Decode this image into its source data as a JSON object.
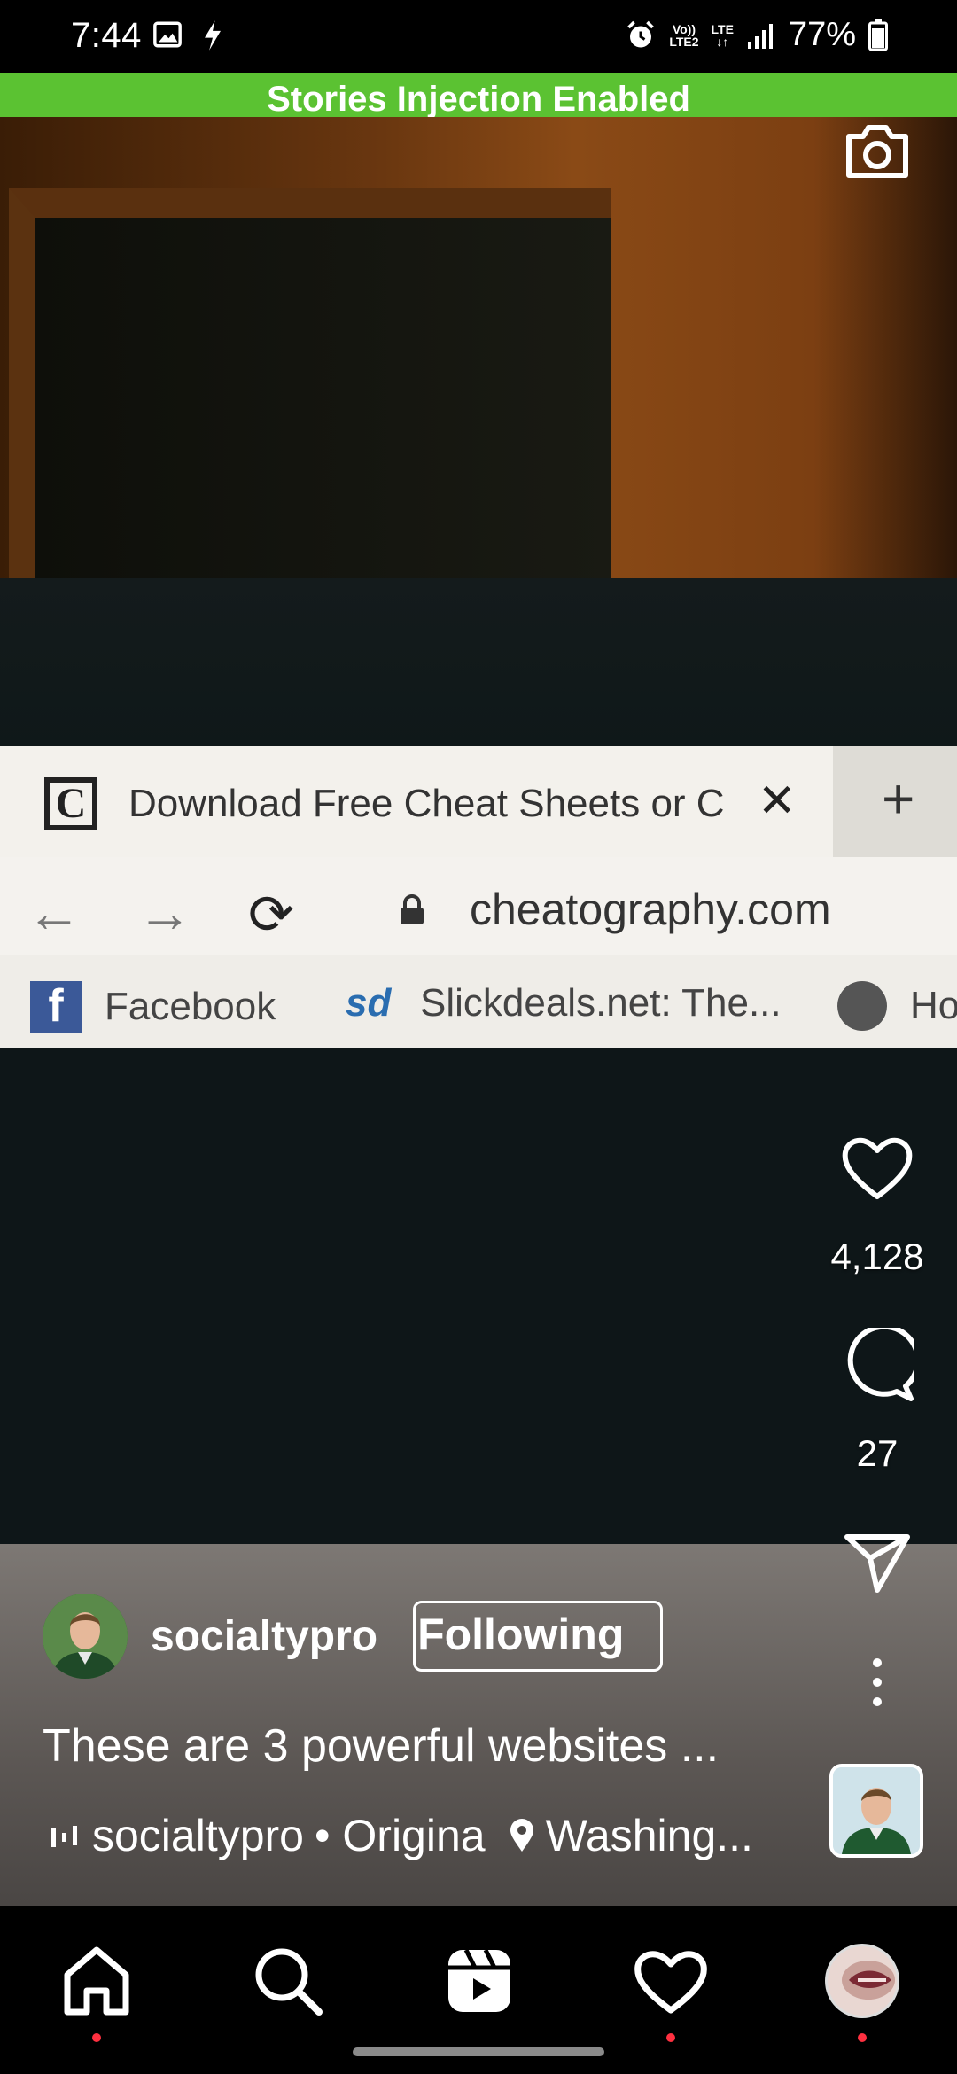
{
  "status_bar": {
    "time": "7:44",
    "left_icons": [
      "image-icon",
      "bolt-icon"
    ],
    "volte_label": "Vo))",
    "lte2_label": "LTE2",
    "lte_label": "LTE",
    "battery": "77%"
  },
  "banner": {
    "text": "Stories Injection Enabled",
    "color": "#5bc232"
  },
  "video_content": {
    "browser_tab_title": "Download Free Cheat Sheets or C",
    "browser_url": "cheatography.com",
    "bookmarks": [
      "Facebook",
      "Slickdeals.net: The...",
      "Ho"
    ]
  },
  "reel": {
    "likes": "4,128",
    "comments": "27",
    "username": "socialtypro",
    "follow_label": "Following",
    "caption": "These are 3 powerful websites ...",
    "audio_author": "socialtypro",
    "audio_type": "• Origina",
    "location": "Washing..."
  },
  "bottom_nav": {
    "items": [
      "home-icon",
      "search-icon",
      "reels-icon",
      "heart-icon",
      "profile-avatar"
    ],
    "notification_color": "#ff3040"
  }
}
